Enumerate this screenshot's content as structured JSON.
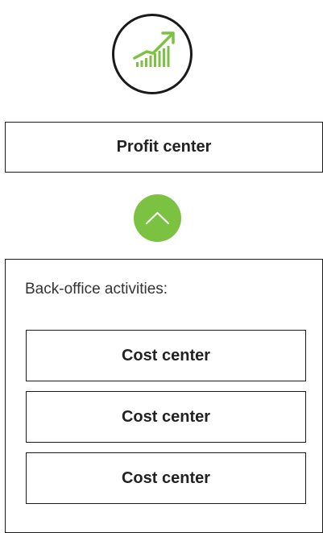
{
  "profit_center": {
    "icon": "growth-chart-icon",
    "label": "Profit center"
  },
  "up_button": {
    "icon": "chevron-up-icon",
    "color": "#7cc242"
  },
  "back_office": {
    "label": "Back-office activities:",
    "cost_centers": [
      {
        "label": "Cost center"
      },
      {
        "label": "Cost center"
      },
      {
        "label": "Cost center"
      }
    ]
  },
  "colors": {
    "accent": "#7cc242",
    "border": "#1a1a1a"
  }
}
